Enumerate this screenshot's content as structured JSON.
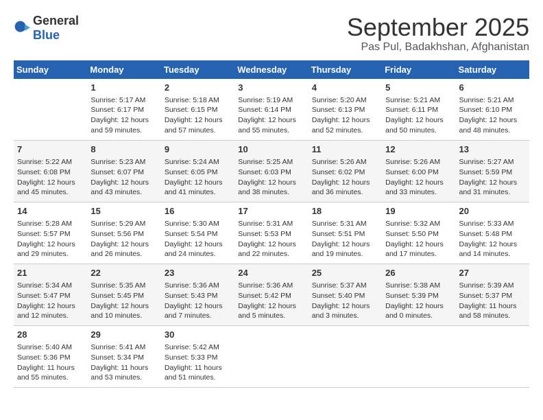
{
  "header": {
    "logo_general": "General",
    "logo_blue": "Blue",
    "month": "September 2025",
    "location": "Pas Pul, Badakhshan, Afghanistan"
  },
  "weekdays": [
    "Sunday",
    "Monday",
    "Tuesday",
    "Wednesday",
    "Thursday",
    "Friday",
    "Saturday"
  ],
  "weeks": [
    [
      {
        "day": "",
        "content": ""
      },
      {
        "day": "1",
        "content": "Sunrise: 5:17 AM\nSunset: 6:17 PM\nDaylight: 12 hours\nand 59 minutes."
      },
      {
        "day": "2",
        "content": "Sunrise: 5:18 AM\nSunset: 6:15 PM\nDaylight: 12 hours\nand 57 minutes."
      },
      {
        "day": "3",
        "content": "Sunrise: 5:19 AM\nSunset: 6:14 PM\nDaylight: 12 hours\nand 55 minutes."
      },
      {
        "day": "4",
        "content": "Sunrise: 5:20 AM\nSunset: 6:13 PM\nDaylight: 12 hours\nand 52 minutes."
      },
      {
        "day": "5",
        "content": "Sunrise: 5:21 AM\nSunset: 6:11 PM\nDaylight: 12 hours\nand 50 minutes."
      },
      {
        "day": "6",
        "content": "Sunrise: 5:21 AM\nSunset: 6:10 PM\nDaylight: 12 hours\nand 48 minutes."
      }
    ],
    [
      {
        "day": "7",
        "content": "Sunrise: 5:22 AM\nSunset: 6:08 PM\nDaylight: 12 hours\nand 45 minutes."
      },
      {
        "day": "8",
        "content": "Sunrise: 5:23 AM\nSunset: 6:07 PM\nDaylight: 12 hours\nand 43 minutes."
      },
      {
        "day": "9",
        "content": "Sunrise: 5:24 AM\nSunset: 6:05 PM\nDaylight: 12 hours\nand 41 minutes."
      },
      {
        "day": "10",
        "content": "Sunrise: 5:25 AM\nSunset: 6:03 PM\nDaylight: 12 hours\nand 38 minutes."
      },
      {
        "day": "11",
        "content": "Sunrise: 5:26 AM\nSunset: 6:02 PM\nDaylight: 12 hours\nand 36 minutes."
      },
      {
        "day": "12",
        "content": "Sunrise: 5:26 AM\nSunset: 6:00 PM\nDaylight: 12 hours\nand 33 minutes."
      },
      {
        "day": "13",
        "content": "Sunrise: 5:27 AM\nSunset: 5:59 PM\nDaylight: 12 hours\nand 31 minutes."
      }
    ],
    [
      {
        "day": "14",
        "content": "Sunrise: 5:28 AM\nSunset: 5:57 PM\nDaylight: 12 hours\nand 29 minutes."
      },
      {
        "day": "15",
        "content": "Sunrise: 5:29 AM\nSunset: 5:56 PM\nDaylight: 12 hours\nand 26 minutes."
      },
      {
        "day": "16",
        "content": "Sunrise: 5:30 AM\nSunset: 5:54 PM\nDaylight: 12 hours\nand 24 minutes."
      },
      {
        "day": "17",
        "content": "Sunrise: 5:31 AM\nSunset: 5:53 PM\nDaylight: 12 hours\nand 22 minutes."
      },
      {
        "day": "18",
        "content": "Sunrise: 5:31 AM\nSunset: 5:51 PM\nDaylight: 12 hours\nand 19 minutes."
      },
      {
        "day": "19",
        "content": "Sunrise: 5:32 AM\nSunset: 5:50 PM\nDaylight: 12 hours\nand 17 minutes."
      },
      {
        "day": "20",
        "content": "Sunrise: 5:33 AM\nSunset: 5:48 PM\nDaylight: 12 hours\nand 14 minutes."
      }
    ],
    [
      {
        "day": "21",
        "content": "Sunrise: 5:34 AM\nSunset: 5:47 PM\nDaylight: 12 hours\nand 12 minutes."
      },
      {
        "day": "22",
        "content": "Sunrise: 5:35 AM\nSunset: 5:45 PM\nDaylight: 12 hours\nand 10 minutes."
      },
      {
        "day": "23",
        "content": "Sunrise: 5:36 AM\nSunset: 5:43 PM\nDaylight: 12 hours\nand 7 minutes."
      },
      {
        "day": "24",
        "content": "Sunrise: 5:36 AM\nSunset: 5:42 PM\nDaylight: 12 hours\nand 5 minutes."
      },
      {
        "day": "25",
        "content": "Sunrise: 5:37 AM\nSunset: 5:40 PM\nDaylight: 12 hours\nand 3 minutes."
      },
      {
        "day": "26",
        "content": "Sunrise: 5:38 AM\nSunset: 5:39 PM\nDaylight: 12 hours\nand 0 minutes."
      },
      {
        "day": "27",
        "content": "Sunrise: 5:39 AM\nSunset: 5:37 PM\nDaylight: 11 hours\nand 58 minutes."
      }
    ],
    [
      {
        "day": "28",
        "content": "Sunrise: 5:40 AM\nSunset: 5:36 PM\nDaylight: 11 hours\nand 55 minutes."
      },
      {
        "day": "29",
        "content": "Sunrise: 5:41 AM\nSunset: 5:34 PM\nDaylight: 11 hours\nand 53 minutes."
      },
      {
        "day": "30",
        "content": "Sunrise: 5:42 AM\nSunset: 5:33 PM\nDaylight: 11 hours\nand 51 minutes."
      },
      {
        "day": "",
        "content": ""
      },
      {
        "day": "",
        "content": ""
      },
      {
        "day": "",
        "content": ""
      },
      {
        "day": "",
        "content": ""
      }
    ]
  ]
}
